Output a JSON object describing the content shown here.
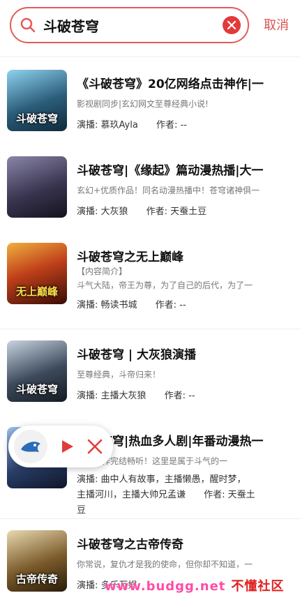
{
  "search": {
    "query": "斗破苍穹",
    "cancel_label": "取消"
  },
  "results": [
    {
      "title": "《斗破苍穹》20亿网络点击神作|一",
      "desc": "影视剧同步|玄幻网文至尊经典小说!",
      "narrator": "演播: 慕玖Ayla",
      "author": "作者: --",
      "cover_text": "斗破苍穹",
      "cover_color": "#2b5d7a"
    },
    {
      "title": "斗破苍穹|《缘起》篇动漫热播|大一",
      "desc": "玄幻+优质作品！同名动漫热播中！苍穹诸神俱一",
      "narrator": "演播: 大灰狼",
      "author": "作者: 天蚕土豆",
      "cover_text": "",
      "cover_color": "#3a3550"
    },
    {
      "title": "斗破苍穹之无上巅峰",
      "desc": "【内容简介】",
      "desc2": "斗气大陆，帝王为尊，为了自己的后代，为了一",
      "narrator": "演播: 畅读书城",
      "author": "作者: --",
      "cover_text": "无上巅峰",
      "cover_color": "#8a2b12"
    },
    {
      "title": "斗破苍穹 | 大灰狼演播",
      "desc": "至尊经典，斗帝归来！",
      "narrator": "演播: 主播大灰狼",
      "author": "作者: --",
      "cover_text": "斗破苍穹",
      "cover_color": "#3d4a5c"
    },
    {
      "title": "斗破苍穹|热血多人剧|年番动漫热一",
      "desc": "玄幻神作完结畅听！这里是属于斗气的一",
      "narrator_line1": "演播: 曲中人有故事，主播懒愚，醒时梦，",
      "narrator_line2": "主播河川，主播大帅兄孟谦",
      "author": "作者: 天蚕土",
      "author_tail": "豆",
      "cover_text": "",
      "cover_color": "#2a3f6a"
    },
    {
      "title": "斗破苍穹之古帝传奇",
      "desc": "你常说，复仇才是我的使命，但你却不知道，一",
      "narrator": "演播: 多乐互娱",
      "author": "",
      "cover_text": "古帝传奇",
      "cover_color": "#7a5a2a"
    }
  ],
  "watermark": {
    "url": "www.budgg.net",
    "site": "不懂社区"
  },
  "colors": {
    "accent": "#e45a5a",
    "clear": "#e23a3a",
    "play": "#e23a3a"
  }
}
